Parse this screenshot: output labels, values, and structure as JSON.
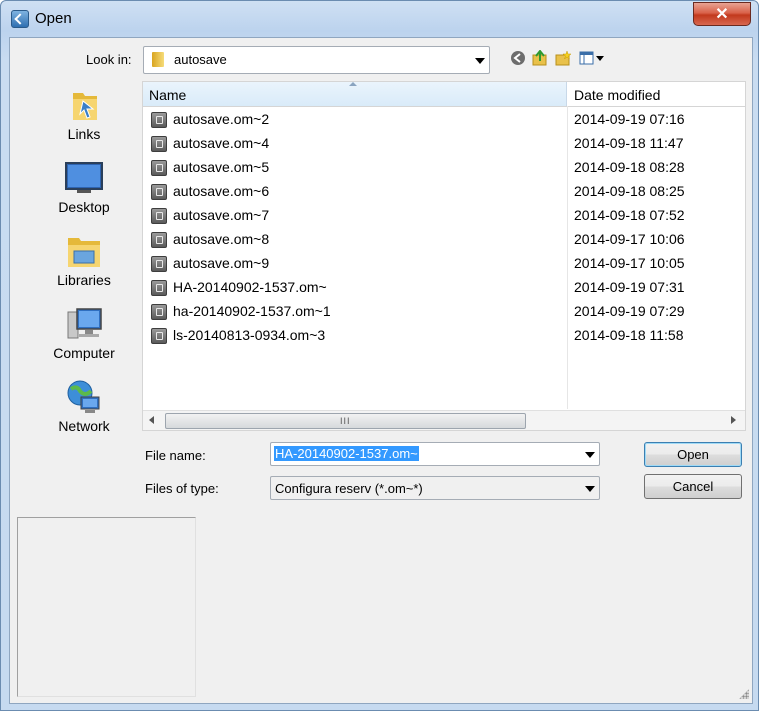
{
  "window": {
    "title": "Open",
    "close_glyph": "✕"
  },
  "lookin": {
    "label": "Look in:",
    "value": "autosave"
  },
  "places": [
    {
      "label": "Links",
      "icon": "links-folder-icon"
    },
    {
      "label": "Desktop",
      "icon": "desktop-icon"
    },
    {
      "label": "Libraries",
      "icon": "libraries-icon"
    },
    {
      "label": "Computer",
      "icon": "computer-icon"
    },
    {
      "label": "Network",
      "icon": "network-icon"
    }
  ],
  "columns": {
    "name": "Name",
    "date": "Date modified"
  },
  "files": [
    {
      "name": "autosave.om~2",
      "date": "2014-09-19 07:16"
    },
    {
      "name": "autosave.om~4",
      "date": "2014-09-18 11:47"
    },
    {
      "name": "autosave.om~5",
      "date": "2014-09-18 08:28"
    },
    {
      "name": "autosave.om~6",
      "date": "2014-09-18 08:25"
    },
    {
      "name": "autosave.om~7",
      "date": "2014-09-18 07:52"
    },
    {
      "name": "autosave.om~8",
      "date": "2014-09-17 10:06"
    },
    {
      "name": "autosave.om~9",
      "date": "2014-09-17 10:05"
    },
    {
      "name": "HA-20140902-1537.om~",
      "date": "2014-09-19 07:31"
    },
    {
      "name": "ha-20140902-1537.om~1",
      "date": "2014-09-19 07:29"
    },
    {
      "name": "ls-20140813-0934.om~3",
      "date": "2014-09-18 11:58"
    }
  ],
  "scroll_grip": "III",
  "filename": {
    "label": "File name:",
    "value": "HA-20140902-1537.om~"
  },
  "filetype": {
    "label": "Files of type:",
    "value": "Configura reserv (*.om~*)"
  },
  "buttons": {
    "open": "Open",
    "cancel": "Cancel"
  },
  "colors": {
    "selection": "#3399ff",
    "close": "#c2391d"
  }
}
